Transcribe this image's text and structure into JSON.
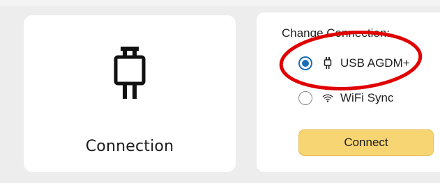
{
  "connection_card": {
    "label": "Connection",
    "icon": "usb-plug-icon"
  },
  "change_panel": {
    "title": "Change Connection:",
    "options": [
      {
        "label": "USB AGDM+",
        "icon": "usb-plug-icon",
        "selected": true
      },
      {
        "label": "WiFi Sync",
        "icon": "wifi-icon",
        "selected": false
      }
    ],
    "connect_label": "Connect"
  },
  "colors": {
    "accent": "#1a6fb8",
    "button": "#f7d572",
    "annotation": "#e00000",
    "background": "#ededed"
  }
}
